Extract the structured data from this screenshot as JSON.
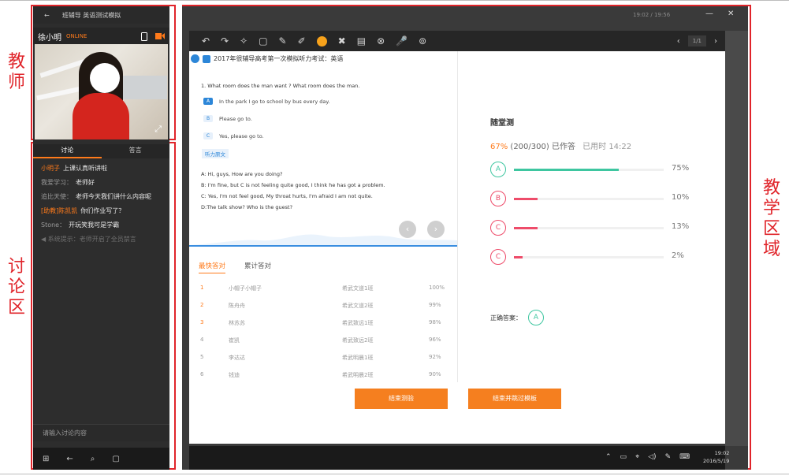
{
  "annotations": {
    "teacher": [
      "教",
      "师"
    ],
    "discussion": [
      "讨",
      "论",
      "区"
    ],
    "teaching": [
      "教",
      "学",
      "区",
      "域"
    ]
  },
  "left": {
    "title_back": "←",
    "title_text": "班辅导  英语测试模拟",
    "teacher_name": "徐小明",
    "teacher_badge": "ONLINE",
    "expand_icon": "⤢",
    "tabs": [
      "讨论",
      "答言"
    ],
    "messages": [
      {
        "who": "小明子",
        "text": "上课认真听讲啦",
        "highlight": true
      },
      {
        "who": "我爱学习：",
        "text": "老师好",
        "highlight": false
      },
      {
        "who": "追比天使：",
        "text": "老师今天我们讲什么内容呢",
        "highlight": false
      },
      {
        "who": "[助教]陈凯凯",
        "text": "你们作业写了？",
        "highlight": true
      },
      {
        "who": "Stone：",
        "text": "开玩笑我可是学霸",
        "highlight": false
      }
    ],
    "system_msg": "◀ 系统提示：老师开启了全员禁言",
    "input_placeholder": "请输入讨论内容",
    "taskbar": [
      "⊞",
      "←",
      "⌕",
      "▢"
    ]
  },
  "right": {
    "title_time": "19:02 / 19:56",
    "window_min": "—",
    "window_close": "✕",
    "toolbar_icons": [
      "↶",
      "↷",
      "✧",
      "▢",
      "✎",
      "✐",
      "✖",
      "▤",
      "⊗",
      "🎤",
      "⊚"
    ],
    "page_prev": "‹",
    "page_label": "1/1",
    "page_next": "›",
    "question": {
      "header": "2017年很辅导高考第一次模拟听力考试：英语",
      "q1": "1. What room does the man want ? What room does the man.",
      "options": [
        {
          "letter": "A",
          "text": "In the park I go to school by bus every day.",
          "selected": true
        },
        {
          "letter": "B",
          "text": "Please go to.",
          "selected": false
        },
        {
          "letter": "C",
          "text": "Yes, please go to.",
          "selected": false
        }
      ],
      "tag": "听力原文",
      "transcript": [
        "A: Hi, guys, How are you doing?",
        "B: I'm fine, but C is not feeling quite good, I think he has got a problem.",
        "C: Yes, I'm not feel good, My throat hurts, I'm afraid I am not quite.",
        "D:The talk show? Who is the guest?"
      ],
      "nav_prev": "‹",
      "nav_next": "›"
    },
    "rank_tabs": [
      "最快答对",
      "累计答对"
    ],
    "rank": [
      {
        "n": "1",
        "name": "小帽子小帽子",
        "cls": "希武文道1班",
        "pct": "100%"
      },
      {
        "n": "2",
        "name": "陈舟舟",
        "cls": "希武文道2班",
        "pct": "99%"
      },
      {
        "n": "3",
        "name": "林苏苏",
        "cls": "希武致远1班",
        "pct": "98%"
      },
      {
        "n": "4",
        "name": "崔凯",
        "cls": "希武致远2班",
        "pct": "96%"
      },
      {
        "n": "5",
        "name": "李达达",
        "cls": "希武明晨1班",
        "pct": "92%"
      },
      {
        "n": "6",
        "name": "钱迪",
        "cls": "希武明晨2班",
        "pct": "90%"
      }
    ],
    "quiz": {
      "title": "随堂测",
      "pct": "67%",
      "count": "(200/300) 已作答",
      "used": "已用时 14:22",
      "bars": [
        {
          "letter": "A",
          "fraction": 0.7,
          "label": "75%",
          "color": "#3ec6a0"
        },
        {
          "letter": "B",
          "fraction": 0.16,
          "label": "10%",
          "color": "#ee4c6a"
        },
        {
          "letter": "C",
          "fraction": 0.16,
          "label": "13%",
          "color": "#ee4c6a"
        },
        {
          "letter": "C",
          "fraction": 0.06,
          "label": "2%",
          "color": "#ee4c6a"
        }
      ],
      "correct_label": "正确答案：",
      "correct_letter": "A"
    },
    "buttons": {
      "end": "结束测验",
      "end_next": "结束并跳过模板"
    },
    "taskbar_icons": [
      "⌃",
      "▭",
      "⌖",
      "◁)",
      "✎",
      "⌨"
    ],
    "clock_time": "19:02",
    "clock_date": "2016/5/19"
  }
}
